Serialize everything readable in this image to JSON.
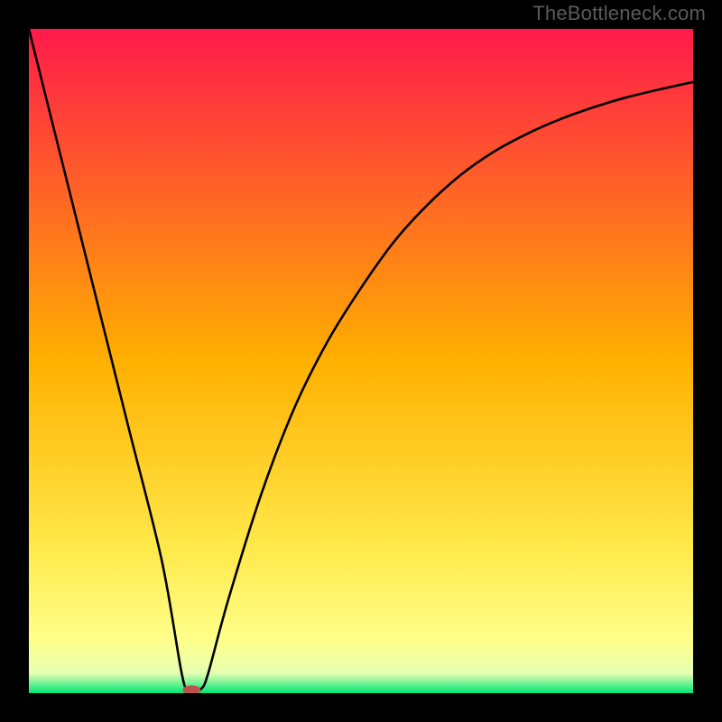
{
  "watermark": "TheBottleneck.com",
  "chart_data": {
    "type": "line",
    "title": "",
    "xlabel": "",
    "ylabel": "",
    "xlim": [
      0,
      100
    ],
    "ylim": [
      0,
      100
    ],
    "grid": false,
    "legend": false,
    "background_gradient": {
      "stops": [
        {
          "offset": 0.0,
          "color": "#ff1a4b"
        },
        {
          "offset": 0.5,
          "color": "#ffb000"
        },
        {
          "offset": 0.78,
          "color": "#ffe94a"
        },
        {
          "offset": 0.92,
          "color": "#ffff8a"
        },
        {
          "offset": 0.97,
          "color": "#e6ffb3"
        },
        {
          "offset": 1.0,
          "color": "#00e676"
        }
      ]
    },
    "series": [
      {
        "name": "bottleneck-curve",
        "x": [
          0,
          5,
          10,
          15,
          20,
          23,
          24,
          25,
          26,
          27,
          30,
          35,
          40,
          45,
          50,
          55,
          60,
          65,
          70,
          75,
          80,
          85,
          90,
          95,
          100
        ],
        "y": [
          100,
          80,
          60,
          40,
          20,
          3,
          0.5,
          0.5,
          0.7,
          3,
          14,
          30,
          43,
          53,
          61,
          68,
          73.5,
          78,
          81.5,
          84.2,
          86.4,
          88.2,
          89.7,
          90.9,
          92
        ]
      }
    ],
    "marker": {
      "name": "optimal-point",
      "x": 24.5,
      "y": 0.5,
      "color": "#c0504d",
      "rx": 10,
      "ry": 5
    }
  }
}
